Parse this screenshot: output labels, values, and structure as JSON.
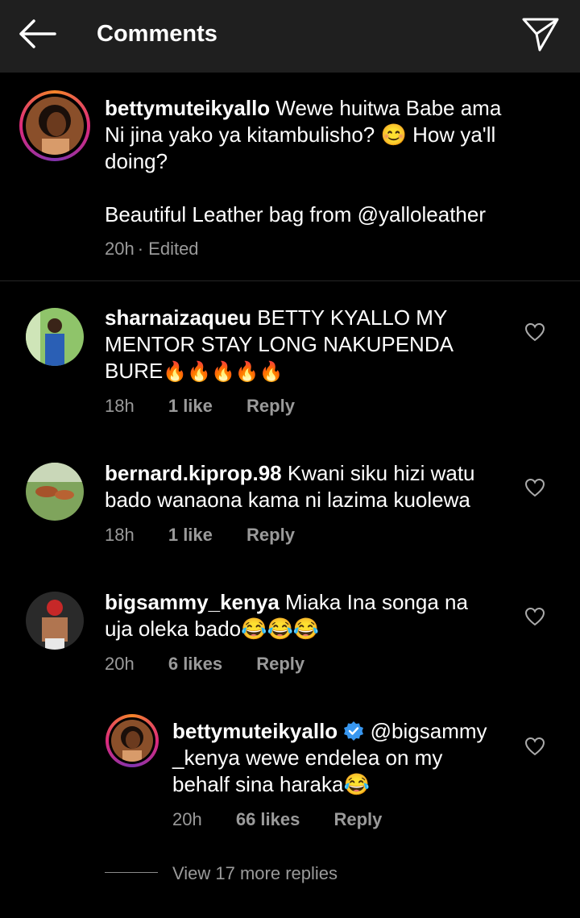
{
  "header": {
    "title": "Comments",
    "back_icon": "arrow-left-icon",
    "send_icon": "paper-plane-icon"
  },
  "caption": {
    "username": "bettymuteikyallo",
    "text_line1": "Wewe huitwa Babe ama",
    "text_line2": "Ni jina yako ya kitambulisho? 😊 How ya'll",
    "text_line3": "doing?",
    "text_line4_prefix": "Beautiful Leather bag from ",
    "mention": "@yalloleather",
    "time": "20h",
    "edited": "· Edited"
  },
  "comments": [
    {
      "username": "sharnaizaqueu",
      "text_line1": "BETTY KYALLO MY",
      "text_line2": "MENTOR STAY LONG NAKUPENDA",
      "text_line3": "BURE",
      "emojis": "🔥🔥🔥🔥🔥",
      "time": "18h",
      "likes": "1 like",
      "reply": "Reply"
    },
    {
      "username": "bernard.kiprop.98",
      "text_line1": "Kwani siku hizi watu",
      "text_line2": "bado wanaona kama ni lazima kuolewa",
      "time": "18h",
      "likes": "1 like",
      "reply": "Reply"
    },
    {
      "username": "bigsammy_kenya",
      "text_line1": "Miaka Ina songa na",
      "text_line2": "uja oleka bado",
      "emojis": "😂😂😂",
      "time": "20h",
      "likes": "6 likes",
      "reply": "Reply"
    }
  ],
  "reply": {
    "username": "bettymuteikyallo",
    "verified_icon": "verified-badge-icon",
    "mention_part1": "@bigsammy",
    "mention_part2": "_kenya",
    "text_line2": " wewe endelea on my",
    "text_line3": "behalf sina haraka",
    "emojis": "😂",
    "time": "20h",
    "likes": "66 likes",
    "reply": "Reply"
  },
  "view_more": "View 17 more replies",
  "colors": {
    "background": "#000000",
    "header": "#1f1f1f",
    "meta": "#9a9a9a",
    "verified": "#3897f0"
  }
}
